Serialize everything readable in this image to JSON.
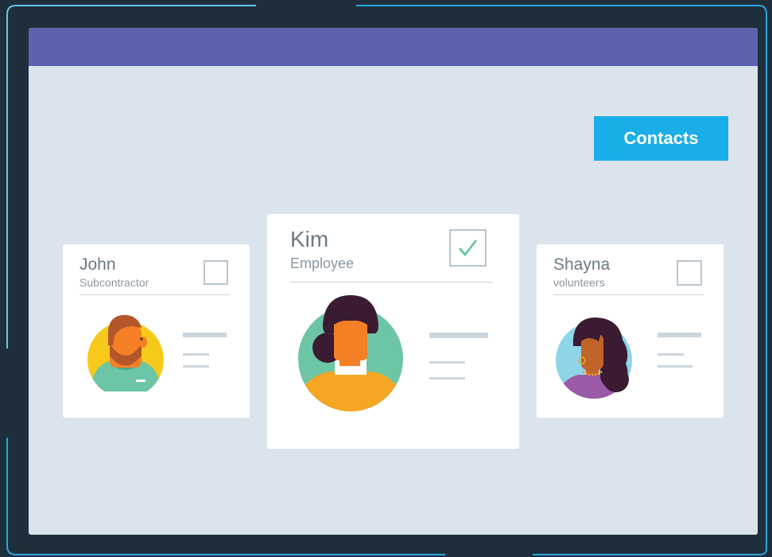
{
  "toolbar": {
    "contacts_label": "Contacts"
  },
  "contacts": [
    {
      "name": "John",
      "role": "Subcontractor",
      "checked": false
    },
    {
      "name": "Kim",
      "role": "Employee",
      "checked": true
    },
    {
      "name": "Shayna",
      "role": "volunteers",
      "checked": false
    }
  ],
  "colors": {
    "background": "#1e2f3b",
    "titlebar": "#5d62ad",
    "window": "#dbe4ec",
    "accent": "#1aaee8",
    "check": "#5cc49c"
  }
}
